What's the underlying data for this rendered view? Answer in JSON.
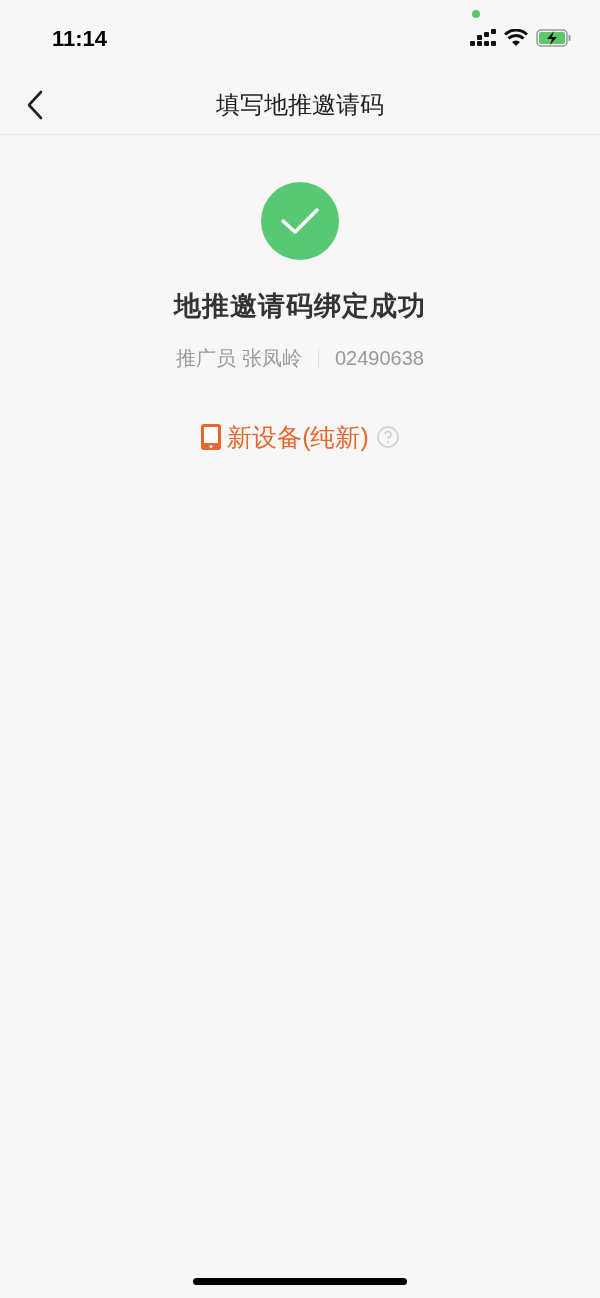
{
  "status_bar": {
    "time": "11:14"
  },
  "nav": {
    "title": "填写地推邀请码"
  },
  "result": {
    "title": "地推邀请码绑定成功",
    "promoter_label": "推广员",
    "promoter_name": "张凤岭",
    "promoter_code": "02490638",
    "device_type": "新设备(纯新)"
  }
}
